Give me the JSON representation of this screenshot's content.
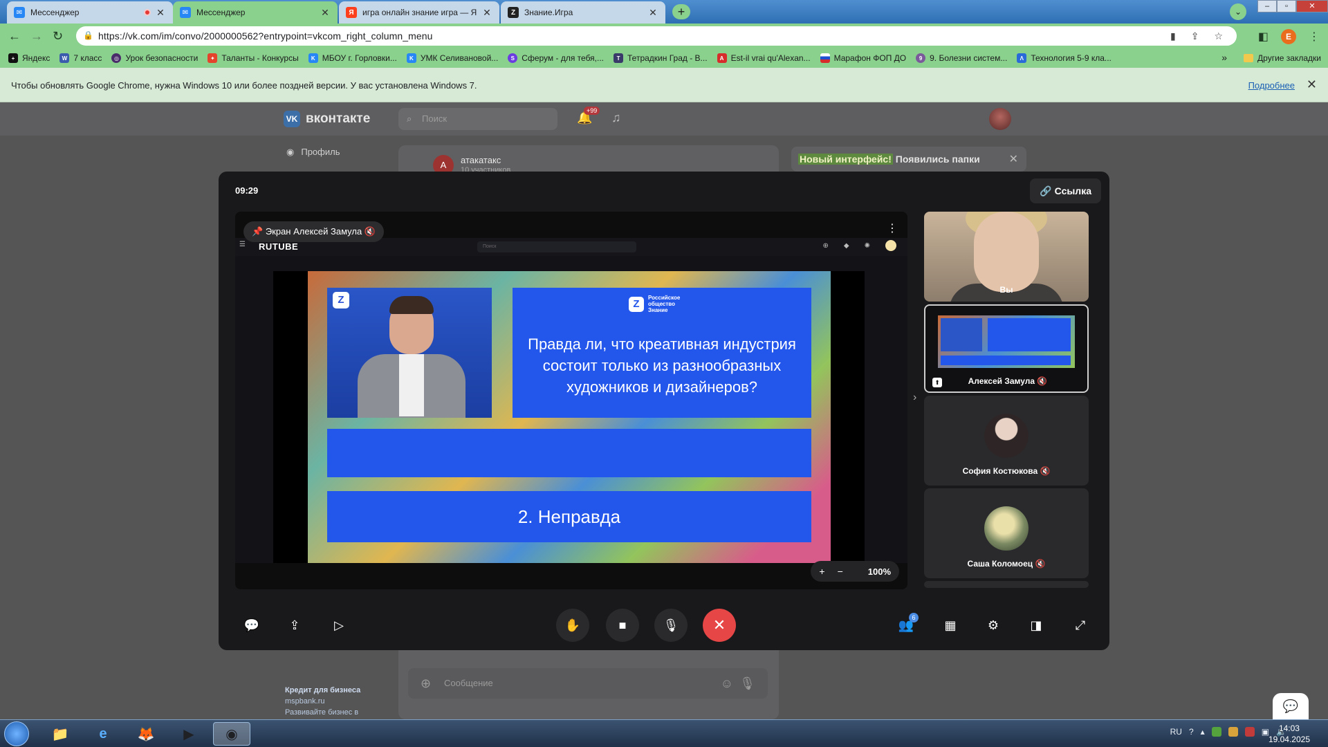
{
  "browser": {
    "tabs": [
      {
        "title": "Мессенджер",
        "favicon": "vk-messenger-icon",
        "state": "inactive",
        "recording": true
      },
      {
        "title": "Мессенджер",
        "favicon": "vk-messenger-icon",
        "state": "active",
        "recording": false
      },
      {
        "title": "игра онлайн знание игра — Янд",
        "favicon": "yandex-icon",
        "state": "inactive",
        "recording": false
      },
      {
        "title": "Знание.Игра",
        "favicon": "znanie-icon",
        "state": "inactive",
        "recording": false
      }
    ],
    "url": "https://vk.com/im/convo/2000000562?entrypoint=vkcom_right_column_menu",
    "profile_initial": "E",
    "bookmarks": [
      "Яндекс",
      "7 класс",
      "Урок безопасности",
      "Таланты - Конкурсы",
      "МБОУ г. Горловки...",
      "УМК Селивановой...",
      "Сферум - для тебя,...",
      "Тетрадкин Град - В...",
      "Est-il vrai qu'Alexan...",
      "Марафон ФОП ДО",
      "9. Болезни систем...",
      "Технология 5-9 кла..."
    ],
    "bookmarks_more": "»",
    "other_bookmarks": "Другие закладки",
    "infobar": {
      "message": "Чтобы обновлять Google Chrome, нужна Windows 10 или более поздней версии. У вас установлена Windows 7.",
      "link": "Подробнее"
    }
  },
  "vk": {
    "logo_text": "вконтакте",
    "search_placeholder": "Поиск",
    "notifications_badge": "+99",
    "sidebar_profile": "Профиль",
    "chat_name": "атакатакс",
    "chat_subtitle": "10 участников",
    "chat_avatar_letter": "А",
    "banner_highlight": "Новый интерфейс!",
    "banner_text": " Появились папки",
    "message_placeholder": "Сообщение",
    "ad_title": "Кредит для бизнеса",
    "ad_domain": "mspbank.ru",
    "ad_text": "Развивайте бизнес в"
  },
  "call": {
    "timer": "09:29",
    "link_button": "Ссылка",
    "screen_label": "Экран Алексей Замула",
    "zoom_level": "100%",
    "shared_screen": {
      "site_logo": "RUTUBE",
      "search_placeholder": "Поиск",
      "org_name_line1": "Российское",
      "org_name_line2": "общество",
      "org_name_line3": "Знание",
      "question": "Правда ли, что креативная индустрия состоит только из разнообразных художников и дизайнеров?",
      "answer": "2. Неправда"
    },
    "participants": [
      {
        "name": "Вы"
      },
      {
        "name": "Алексей Замула"
      },
      {
        "name": "София Костюкова"
      },
      {
        "name": "Саша Коломоец"
      }
    ],
    "participants_badge": "6"
  },
  "taskbar": {
    "language": "RU",
    "time": "14:03",
    "date": "19.04.2025"
  }
}
